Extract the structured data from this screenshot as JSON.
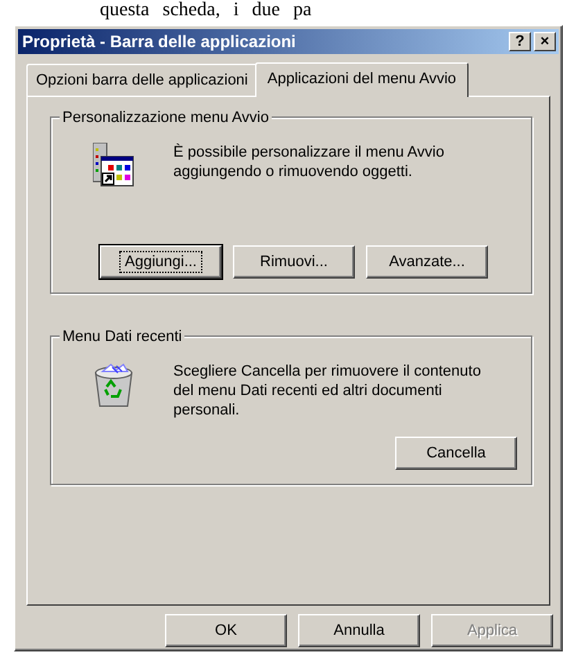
{
  "background_text": "questa scheda, i due pa",
  "window": {
    "title": "Proprietà - Barra delle applicazioni",
    "title_buttons": [
      "?",
      "×"
    ]
  },
  "tabs": [
    {
      "label": "Opzioni barra delle applicazioni",
      "selected": false
    },
    {
      "label": "Applicazioni del menu Avvio",
      "selected": true
    }
  ],
  "groups": [
    {
      "title": "Personalizzazione menu Avvio",
      "kind": "startmenu",
      "text": "È possibile personalizzare il menu Avvio aggiungendo o rimuovendo oggetti.",
      "buttons": [
        {
          "label": "Aggiungi...",
          "focused": true,
          "disabled": false
        },
        {
          "label": "Rimuovi...",
          "focused": false,
          "disabled": false
        },
        {
          "label": "Avanzate...",
          "focused": false,
          "disabled": false
        }
      ]
    },
    {
      "title": "Menu Dati recenti",
      "kind": "recent",
      "text": "Scegliere Cancella per rimuovere il contenuto del menu Dati recenti ed altri documenti personali.",
      "buttons": [
        {
          "label": "Cancella",
          "focused": false,
          "disabled": false
        }
      ]
    }
  ],
  "dialog_buttons": [
    {
      "label": "OK",
      "disabled": false
    },
    {
      "label": "Annulla",
      "disabled": false
    },
    {
      "label": "Applica",
      "disabled": true
    }
  ]
}
